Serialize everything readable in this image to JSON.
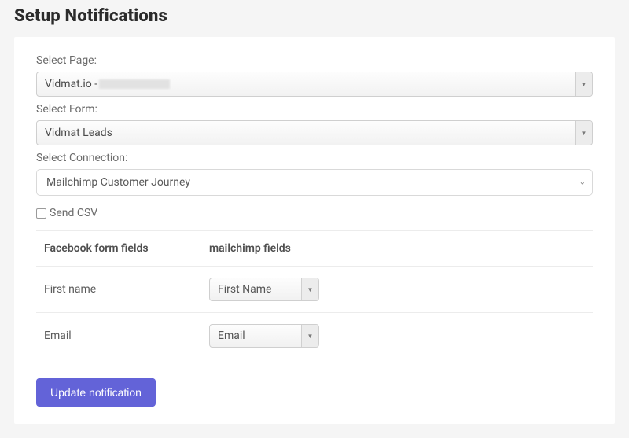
{
  "title": "Setup Notifications",
  "selectPage": {
    "label": "Select Page:",
    "valuePrefix": "Vidmat.io - "
  },
  "selectForm": {
    "label": "Select Form:",
    "value": "Vidmat Leads"
  },
  "selectConnection": {
    "label": "Select Connection:",
    "value": "Mailchimp Customer Journey"
  },
  "sendCsv": {
    "label": "Send CSV",
    "checked": false
  },
  "mapping": {
    "header": {
      "source": "Facebook form fields",
      "target": "mailchimp fields"
    },
    "rows": [
      {
        "source": "First name",
        "target": "First Name"
      },
      {
        "source": "Email",
        "target": "Email"
      }
    ]
  },
  "submitLabel": "Update notification"
}
